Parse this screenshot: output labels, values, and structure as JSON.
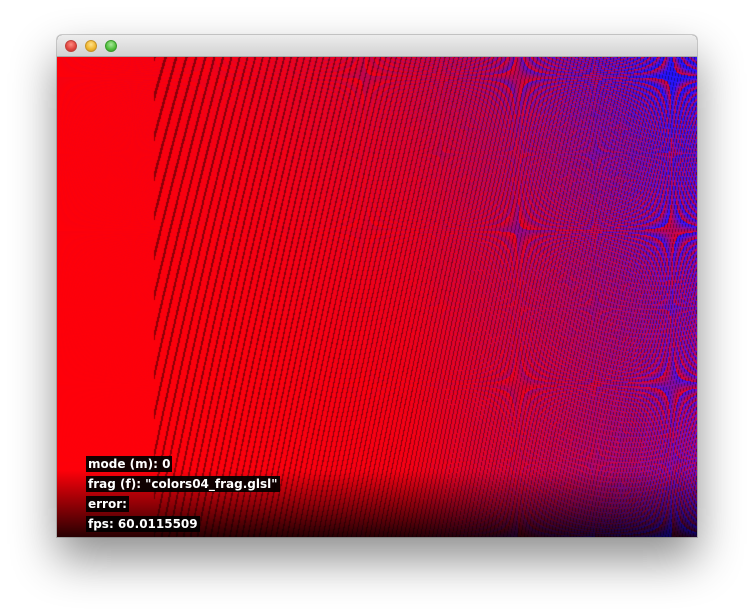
{
  "window": {
    "title": "",
    "controls": {
      "close_icon": "close-traffic-light",
      "minimize_icon": "minimize-traffic-light",
      "zoom_icon": "zoom-traffic-light"
    },
    "colors": {
      "close": "#e0443e",
      "minimize": "#f0b52c",
      "zoom": "#4fbf3b"
    }
  },
  "shader_view": {
    "primary_color": "#ff0000",
    "secondary_color": "#0000ff",
    "background": "#000000"
  },
  "overlay": {
    "mode_line": "mode (m): 0",
    "frag_line": "frag (f): \"colors04_frag.glsl\"",
    "error_line": "error:",
    "fps_line": "fps: 60.0115509"
  }
}
